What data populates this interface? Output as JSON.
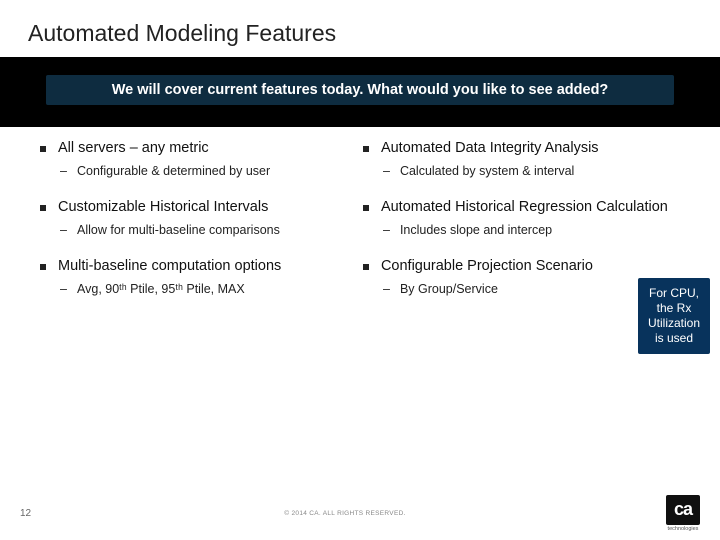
{
  "title": "Automated Modeling Features",
  "banner": "We will cover current features today. What would you like to see added?",
  "left": [
    {
      "head": "All servers – any metric",
      "subs": [
        "Configurable & determined by user"
      ]
    },
    {
      "head": "Customizable Historical Intervals",
      "subs": [
        "Allow for multi-baseline comparisons"
      ]
    },
    {
      "head": "Multi-baseline computation options",
      "subs": [
        "Avg, 90ᵗʰ Ptile, 95ᵗʰ Ptile, MAX"
      ]
    }
  ],
  "right": [
    {
      "head": "Automated Data Integrity Analysis",
      "subs": [
        "Calculated by system & interval"
      ]
    },
    {
      "head": "Automated Historical Regression Calculation",
      "subs": [
        "Includes slope and intercep"
      ]
    },
    {
      "head": "Configurable Projection Scenario",
      "subs": [
        "By Group/Service"
      ]
    }
  ],
  "callout": "For CPU, the Rx Utilization is used",
  "pagenum": "12",
  "copyright": "© 2014 CA. ALL RIGHTS RESERVED.",
  "logo": {
    "mark": "ca",
    "sub": "technologies"
  }
}
